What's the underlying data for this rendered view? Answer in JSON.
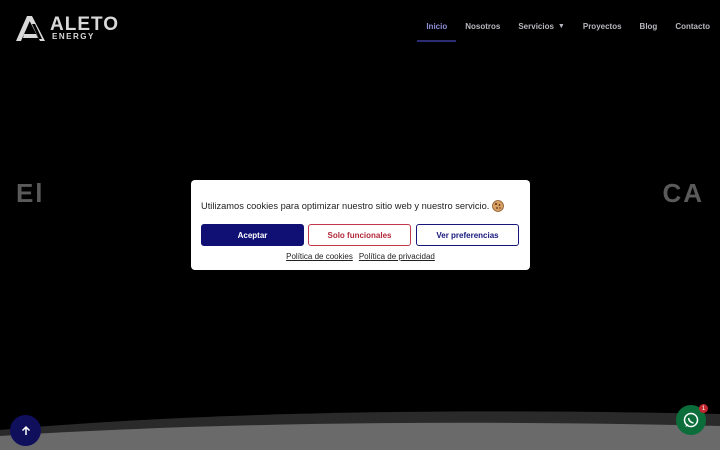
{
  "brand": {
    "name": "ALETO",
    "tagline": "ENERGY"
  },
  "nav": {
    "items": [
      {
        "label": "Inicio",
        "active": true
      },
      {
        "label": "Nosotros"
      },
      {
        "label": "Servicios",
        "has_dropdown": true
      },
      {
        "label": "Proyectos"
      },
      {
        "label": "Blog"
      },
      {
        "label": "Contacto"
      }
    ]
  },
  "hero": {
    "title_visible": "El                                                                   CA"
  },
  "cookie_banner": {
    "message": "Utilizamos cookies para optimizar nuestro sitio web y nuestro servicio.",
    "icon": "cookie-icon",
    "accept_label": "Aceptar",
    "functional_label": "Solo funcionales",
    "preferences_label": "Ver preferencias",
    "links": {
      "cookies": "Política de cookies",
      "privacy": "Política de privacidad"
    }
  },
  "floating": {
    "scroll_top_icon": "arrow-up-icon",
    "whatsapp_icon": "whatsapp-icon",
    "whatsapp_badge": "1"
  },
  "colors": {
    "accent": "#0f0f74",
    "nav_active": "#8f8fd8",
    "functional_button": "#c23a4a",
    "whatsapp": "#0b6e3a"
  }
}
